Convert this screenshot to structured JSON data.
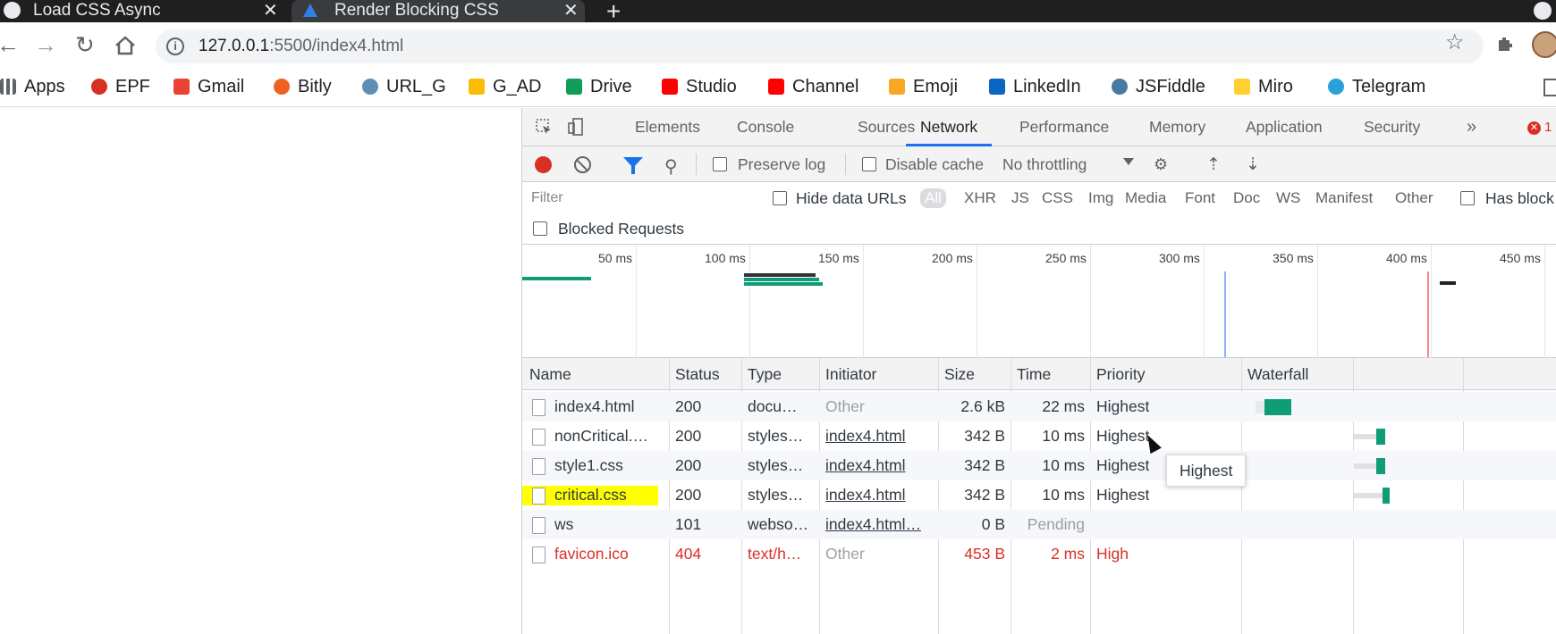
{
  "tabs": [
    {
      "title": "Load CSS Async"
    },
    {
      "title": "Render Blocking CSS"
    }
  ],
  "toolbar": {
    "url_host": "127.0.0.1",
    "url_rest": ":5500/index4.html"
  },
  "bookmarks": [
    {
      "label": "Apps",
      "icon": "apps-grid-icon",
      "color": "#5f6368"
    },
    {
      "label": "EPF",
      "icon": "epf-icon",
      "color": "#d93025"
    },
    {
      "label": "Gmail",
      "icon": "gmail-icon",
      "color": "#ea4335"
    },
    {
      "label": "Bitly",
      "icon": "bitly-icon",
      "color": "#ee6123"
    },
    {
      "label": "URL_G",
      "icon": "link-icon",
      "color": "#5f8fb4"
    },
    {
      "label": "G_AD",
      "icon": "google-ads-icon",
      "color": "#fbbc04"
    },
    {
      "label": "Drive",
      "icon": "drive-icon",
      "color": "#0f9d58"
    },
    {
      "label": "Studio",
      "icon": "youtube-icon",
      "color": "#ff0000"
    },
    {
      "label": "Channel",
      "icon": "youtube-icon",
      "color": "#ff0000"
    },
    {
      "label": "Emoji",
      "icon": "emoji-icon",
      "color": "#f9a825"
    },
    {
      "label": "LinkedIn",
      "icon": "linkedin-icon",
      "color": "#0a66c2"
    },
    {
      "label": "JSFiddle",
      "icon": "cloud-icon",
      "color": "#4679a4"
    },
    {
      "label": "Miro",
      "icon": "miro-icon",
      "color": "#ffd02f"
    },
    {
      "label": "Telegram",
      "icon": "telegram-icon",
      "color": "#2aa1da"
    }
  ],
  "devtools": {
    "tabs": [
      "Elements",
      "Console",
      "Sources",
      "Network",
      "Performance",
      "Memory",
      "Application",
      "Security"
    ],
    "active_tab": "Network",
    "error_count": "1",
    "toolbar": {
      "preserve_log": "Preserve log",
      "disable_cache": "Disable cache",
      "throttling": "No throttling"
    },
    "filter": {
      "placeholder": "Filter",
      "hide_data_urls": "Hide data URLs",
      "types": [
        "All",
        "XHR",
        "JS",
        "CSS",
        "Img",
        "Media",
        "Font",
        "Doc",
        "WS",
        "Manifest",
        "Other"
      ],
      "has_blocked": "Has block",
      "blocked_requests": "Blocked Requests"
    },
    "overview_ticks": [
      "50 ms",
      "100 ms",
      "150 ms",
      "200 ms",
      "250 ms",
      "300 ms",
      "350 ms",
      "400 ms",
      "450 ms"
    ],
    "columns": [
      "Name",
      "Status",
      "Type",
      "Initiator",
      "Size",
      "Time",
      "Priority",
      "Waterfall"
    ],
    "requests": [
      {
        "name": "index4.html",
        "status": "200",
        "type": "docu…",
        "initiator": "Other",
        "size": "2.6 kB",
        "time": "22 ms",
        "priority": "Highest"
      },
      {
        "name": "nonCritical.…",
        "status": "200",
        "type": "styles…",
        "initiator": "index4.html",
        "size": "342 B",
        "time": "10 ms",
        "priority": "Highest"
      },
      {
        "name": "style1.css",
        "status": "200",
        "type": "styles…",
        "initiator": "index4.html",
        "size": "342 B",
        "time": "10 ms",
        "priority": "Highest"
      },
      {
        "name": "critical.css",
        "status": "200",
        "type": "styles…",
        "initiator": "index4.html",
        "size": "342 B",
        "time": "10 ms",
        "priority": "Highest"
      },
      {
        "name": "ws",
        "status": "101",
        "type": "webso…",
        "initiator": "index4.html…",
        "size": "0 B",
        "time": "Pending",
        "priority": ""
      },
      {
        "name": "favicon.ico",
        "status": "404",
        "type": "text/h…",
        "initiator": "Other",
        "size": "453 B",
        "time": "2 ms",
        "priority": "High"
      }
    ],
    "tooltip": "Highest"
  }
}
